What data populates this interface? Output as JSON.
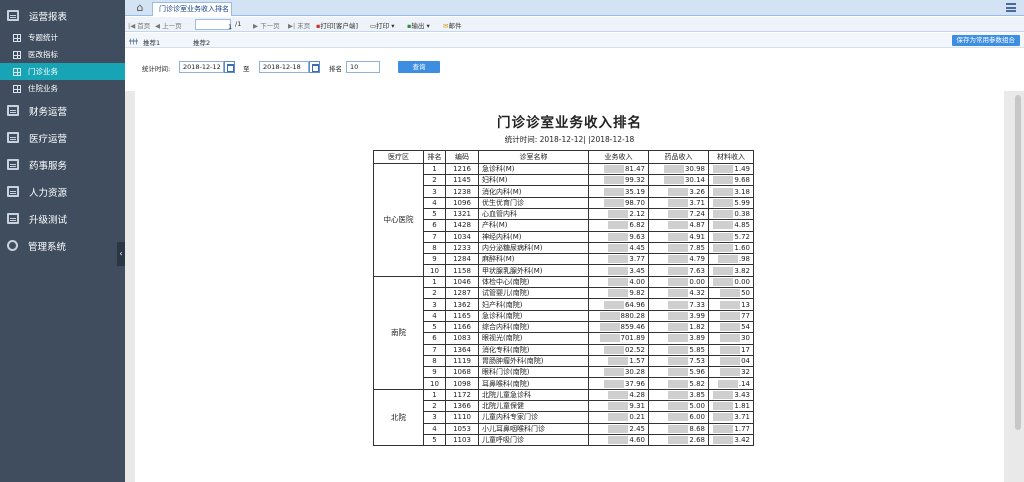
{
  "sidebar": {
    "items": [
      {
        "label": "运营报表",
        "icon": "report-icon",
        "expanded": true
      },
      {
        "label": "财务运营",
        "icon": "report-icon"
      },
      {
        "label": "医疗运营",
        "icon": "report-icon"
      },
      {
        "label": "药事服务",
        "icon": "report-icon"
      },
      {
        "label": "人力资源",
        "icon": "report-icon"
      },
      {
        "label": "升级测试",
        "icon": "report-icon"
      },
      {
        "label": "管理系统",
        "icon": "gear-icon"
      }
    ],
    "subitems": [
      {
        "label": "专题统计",
        "active": false
      },
      {
        "label": "医改指标",
        "active": false
      },
      {
        "label": "门诊业务",
        "active": true
      },
      {
        "label": "住院业务",
        "active": false
      }
    ],
    "active_color": "#17a5b5"
  },
  "tabs": {
    "home_icon": "home-icon",
    "active": "门诊诊室业务收入排名"
  },
  "toolbar": {
    "first": "首页",
    "prev": "上一页",
    "page": "1",
    "total": "/1",
    "next": "下一页",
    "last": "末页",
    "print_client": "打印[客户端]",
    "print": "打印",
    "export": "输出",
    "mail": "邮件"
  },
  "recommend": {
    "label1": "推荐1",
    "label2": "推荐2",
    "save": "保存为常用参数组合"
  },
  "filter": {
    "label_time": "统计时间:",
    "start": "2018-12-12",
    "to": "至",
    "end": "2018-12-18",
    "label_rank": "排名",
    "rank": "10",
    "query": "查询"
  },
  "report": {
    "title": "门诊诊室业务收入排名",
    "period": "统计时间: 2018-12-12| |2018-12-18",
    "headers": [
      "医疗区",
      "排名",
      "编码",
      "诊室名称",
      "业务收入",
      "药品收入",
      "材料收入"
    ],
    "groups": [
      {
        "region": "中心医院",
        "rows": [
          [
            "1",
            "1216",
            "急诊科(M)",
            "81.47",
            "30.98",
            "1.49"
          ],
          [
            "2",
            "1145",
            "妇科(M)",
            "99.32",
            "30.14",
            "9.68"
          ],
          [
            "3",
            "1238",
            "消化内科(M)",
            "35.19",
            "3.26",
            "3.18"
          ],
          [
            "4",
            "1096",
            "优生优育门诊",
            "98.70",
            "3.71",
            "5.99"
          ],
          [
            "5",
            "1321",
            "心血管内科",
            "2.12",
            "7.24",
            "0.38"
          ],
          [
            "6",
            "1428",
            "产科(M)",
            "6.82",
            "4.87",
            "4.85"
          ],
          [
            "7",
            "1034",
            "神经内科(M)",
            "9.63",
            "4.91",
            "5.72"
          ],
          [
            "8",
            "1233",
            "内分泌糖尿病科(M)",
            "4.45",
            "7.85",
            "1.60"
          ],
          [
            "9",
            "1284",
            "麻醉科(M)",
            "3.77",
            "4.79",
            ".98"
          ],
          [
            "10",
            "1158",
            "甲状腺乳腺外科(M)",
            "3.45",
            "7.63",
            "3.82"
          ]
        ]
      },
      {
        "region": "南院",
        "rows": [
          [
            "1",
            "1046",
            "体检中心(南院)",
            "4.00",
            "0.00",
            "0.00"
          ],
          [
            "2",
            "1287",
            "试管婴儿(南院)",
            "9.82",
            "4.32",
            "50"
          ],
          [
            "3",
            "1362",
            "妇产科(南院)",
            "64.96",
            "7.33",
            "13"
          ],
          [
            "4",
            "1165",
            "急诊科(南院)",
            "880.28",
            "3.99",
            "77"
          ],
          [
            "5",
            "1166",
            "综合内科(南院)",
            "859.46",
            "1.82",
            "54"
          ],
          [
            "6",
            "1083",
            "眼视光(南院)",
            "701.89",
            "3.89",
            "30"
          ],
          [
            "7",
            "1364",
            "消化专科(南院)",
            "02.52",
            "5.85",
            "17"
          ],
          [
            "8",
            "1119",
            "胃肠肿瘤外科(南院)",
            "1.57",
            "7.53",
            "04"
          ],
          [
            "9",
            "1068",
            "眼科门诊(南院)",
            "30.28",
            "5.96",
            "32"
          ],
          [
            "10",
            "1098",
            "耳鼻喉科(南院)",
            "37.96",
            "5.82",
            ".14"
          ]
        ]
      },
      {
        "region": "北院",
        "rows": [
          [
            "1",
            "1172",
            "北院儿童急诊科",
            "4.28",
            "3.85",
            "3.43"
          ],
          [
            "2",
            "1366",
            "北院儿童保健",
            "9.31",
            "5.00",
            "1.81"
          ],
          [
            "3",
            "1110",
            "儿童内科专家门诊",
            "0.21",
            "6.00",
            "3.71"
          ],
          [
            "4",
            "1053",
            "小儿耳鼻咽喉科门诊",
            "2.45",
            "8.68",
            "1.77"
          ],
          [
            "5",
            "1103",
            "儿童呼吸门诊",
            "4.60",
            "2.68",
            "3.42"
          ]
        ]
      }
    ]
  }
}
